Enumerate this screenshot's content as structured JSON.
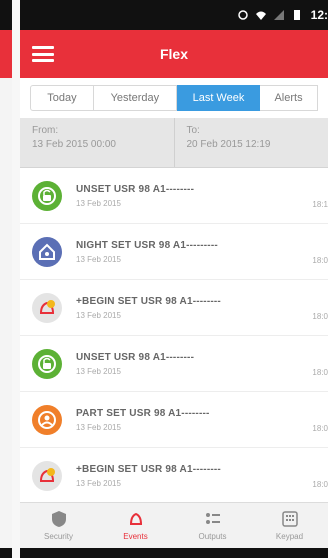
{
  "status_bar": {
    "time": "12:"
  },
  "app_bar": {
    "title": "Flex"
  },
  "tabs": [
    {
      "label": "Today"
    },
    {
      "label": "Yesterday"
    },
    {
      "label": "Last Week"
    },
    {
      "label": "Alerts"
    }
  ],
  "date_range": {
    "from_label": "From:",
    "from_value": "13 Feb 2015 00:00",
    "to_label": "To:",
    "to_value": "20 Feb 2015 12:19"
  },
  "events": [
    {
      "name": "UNSET USR 98 A1--------",
      "date": "13 Feb 2015",
      "time": "18:1",
      "icon": "unset-icon",
      "color": "#5cb135"
    },
    {
      "name": "NIGHT SET USR 98 A1---------",
      "date": "13 Feb 2015",
      "time": "18:0",
      "icon": "night-set-icon",
      "color": "#5b6fb5"
    },
    {
      "name": "+BEGIN SET USR 98 A1--------",
      "date": "13 Feb 2015",
      "time": "18:0",
      "icon": "begin-set-icon",
      "color": "#e0e0e0"
    },
    {
      "name": "UNSET USR 98 A1--------",
      "date": "13 Feb 2015",
      "time": "18:0",
      "icon": "unset-icon",
      "color": "#5cb135"
    },
    {
      "name": "PART SET USR 98 A1--------",
      "date": "13 Feb 2015",
      "time": "18:0",
      "icon": "part-set-icon",
      "color": "#f07f2a"
    },
    {
      "name": "+BEGIN SET USR 98 A1--------",
      "date": "13 Feb 2015",
      "time": "18:0",
      "icon": "begin-set-icon",
      "color": "#e0e0e0"
    }
  ],
  "bottom_nav": [
    {
      "label": "Security",
      "icon": "security-icon"
    },
    {
      "label": "Events",
      "icon": "events-icon"
    },
    {
      "label": "Outputs",
      "icon": "outputs-icon"
    },
    {
      "label": "Keypad",
      "icon": "keypad-icon"
    }
  ],
  "colors": {
    "accent": "#e8303a",
    "tab_active": "#3a9be0"
  }
}
